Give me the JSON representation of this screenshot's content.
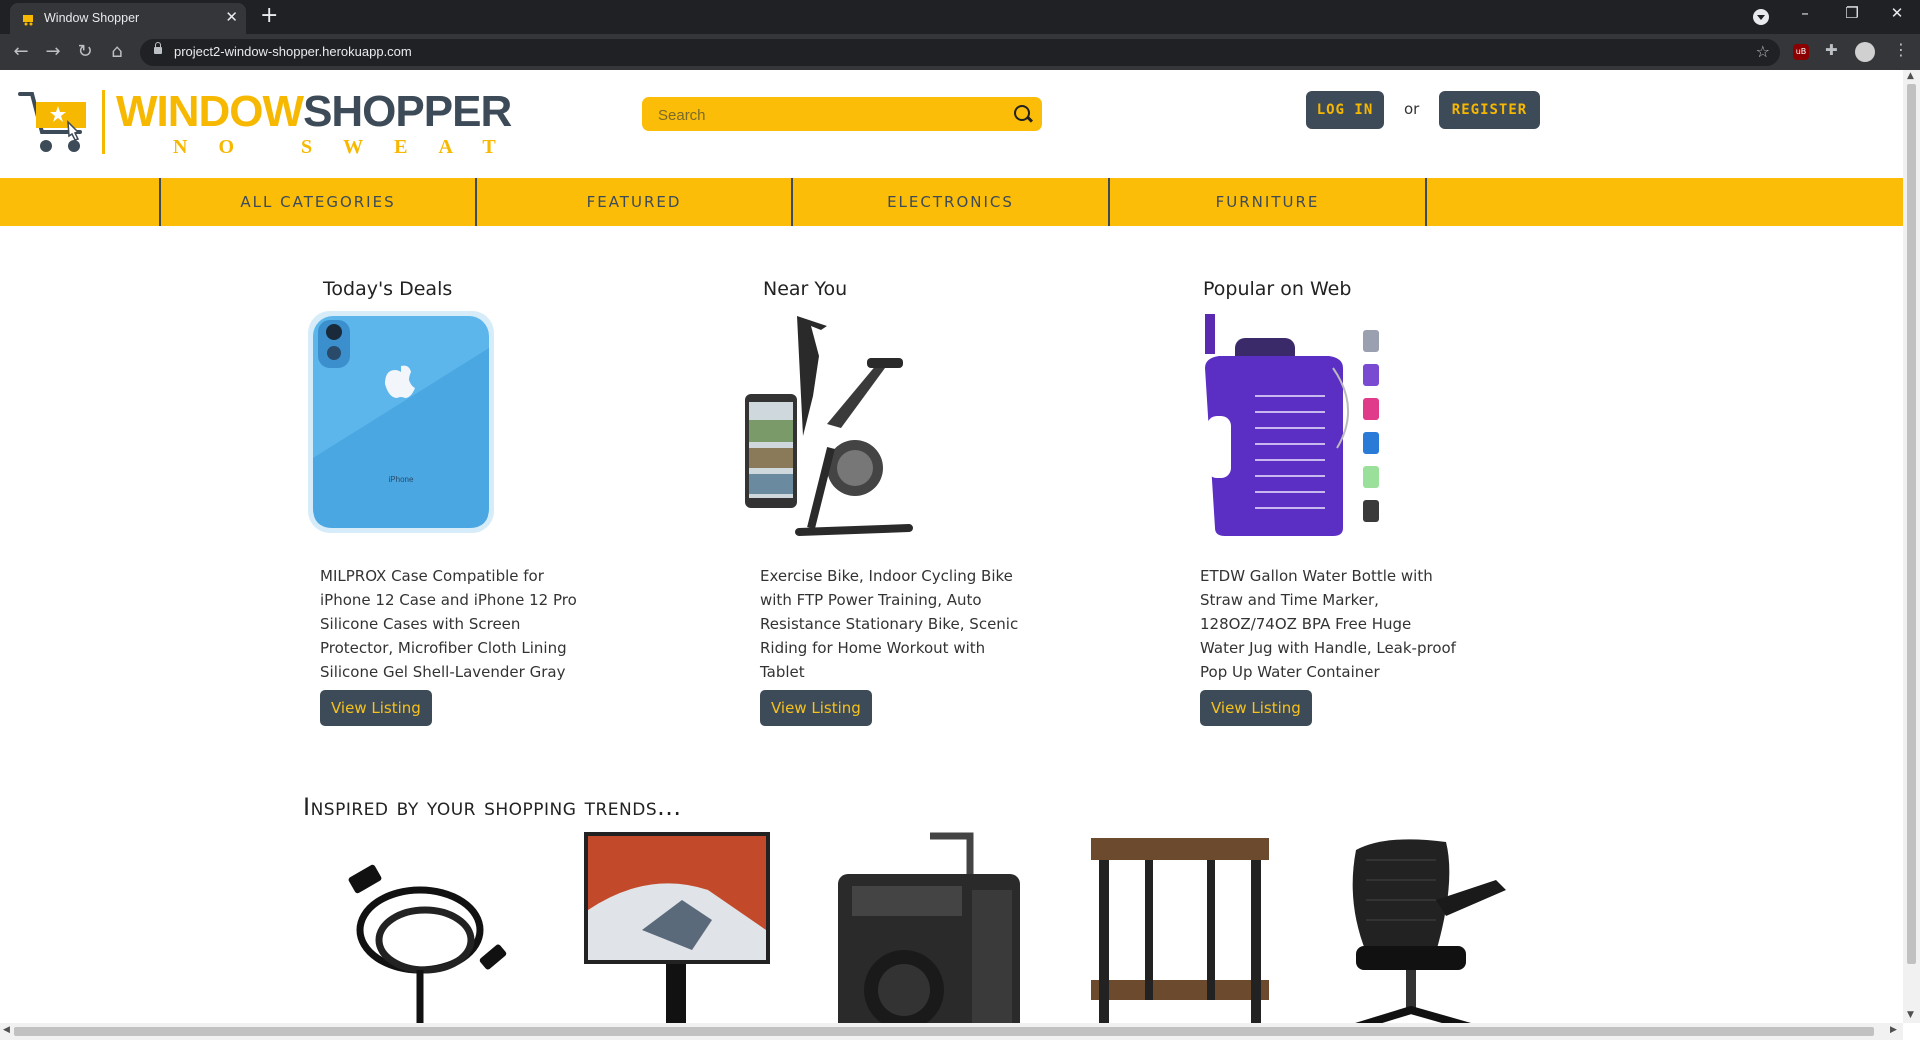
{
  "browser": {
    "tab_title": "Window Shopper",
    "close_glyph": "✕",
    "new_tab_glyph": "+",
    "url": "project2-window-shopper.herokuapp.com",
    "win_minimize": "–",
    "win_restore": "❐",
    "win_close": "✕",
    "ext_ub_text": "uB"
  },
  "header": {
    "logo_word1": "WINDOW",
    "logo_word2": "SHOPPER",
    "logo_sub": "NO SWEAT",
    "search_placeholder": "Search",
    "login_label": "LOG IN",
    "or_text": "or",
    "register_label": "REGISTER"
  },
  "nav": {
    "items": [
      {
        "label": "ALL CATEGORIES"
      },
      {
        "label": "FEATURED"
      },
      {
        "label": "ELECTRONICS"
      },
      {
        "label": "FURNITURE"
      }
    ]
  },
  "deals": [
    {
      "title": "Today's Deals",
      "description": "MILPROX Case Compatible for iPhone 12 Case and iPhone 12 Pro Silicone Cases with Screen Protector, Microfiber Cloth Lining Silicone Gel Shell-Lavender Gray",
      "button": "View Listing",
      "image_label": "iPhone"
    },
    {
      "title": "Near You",
      "description": "Exercise Bike, Indoor Cycling Bike with FTP Power Training, Auto Resistance Stationary Bike, Scenic Riding for Home Workout with Tablet",
      "button": "View Listing"
    },
    {
      "title": "Popular on Web",
      "description": "ETDW Gallon Water Bottle with Straw and Time Marker, 128OZ/74OZ BPA Free Huge Water Jug with Handle, Leak-proof Pop Up Water Container",
      "button": "View Listing"
    }
  ],
  "trends": {
    "title": "Inspired by your shopping trends..."
  },
  "colors": {
    "brand_yellow": "#fbbd08",
    "brand_slate": "#3d4a57"
  }
}
